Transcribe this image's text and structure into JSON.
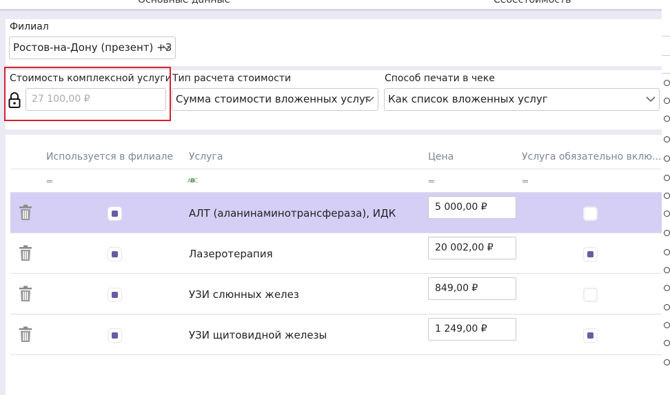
{
  "tabs": [
    "Основные данные",
    "Себестоимость"
  ],
  "branch": {
    "label": "Филиал",
    "value": "Ростов-на-Дону (презент) +3"
  },
  "cost": {
    "label": "Стоимость комплексной услуги",
    "placeholder": "27 100,00 ₽"
  },
  "calc_type": {
    "label": "Тип расчета стоимости",
    "value": "Сумма стоимости вложенных услуг"
  },
  "print_mode": {
    "label": "Способ печати в чеке",
    "value": "Как список вложенных услуг"
  },
  "table": {
    "headers": {
      "used": "Используется в филиале",
      "service": "Услуга",
      "price": "Цена",
      "required": "Услуга обязательно вклю..."
    },
    "rows": [
      {
        "service": "АЛТ (аланинаминотрансфераза), ИДК",
        "price": "5 000,00 ₽",
        "used": true,
        "required": false,
        "selected": true
      },
      {
        "service": "Лазеротерапия",
        "price": "20 002,00 ₽",
        "used": true,
        "required": true,
        "selected": false
      },
      {
        "service": "УЗИ слюнных желез",
        "price": "849,00 ₽",
        "used": true,
        "required": false,
        "selected": false
      },
      {
        "service": "УЗИ щитовидной железы",
        "price": "1 249,00 ₽",
        "used": true,
        "required": true,
        "selected": false
      }
    ]
  },
  "colors": {
    "accent": "#6c5aa4",
    "selected_row": "#d5cff6",
    "highlight": "#d2202f"
  }
}
